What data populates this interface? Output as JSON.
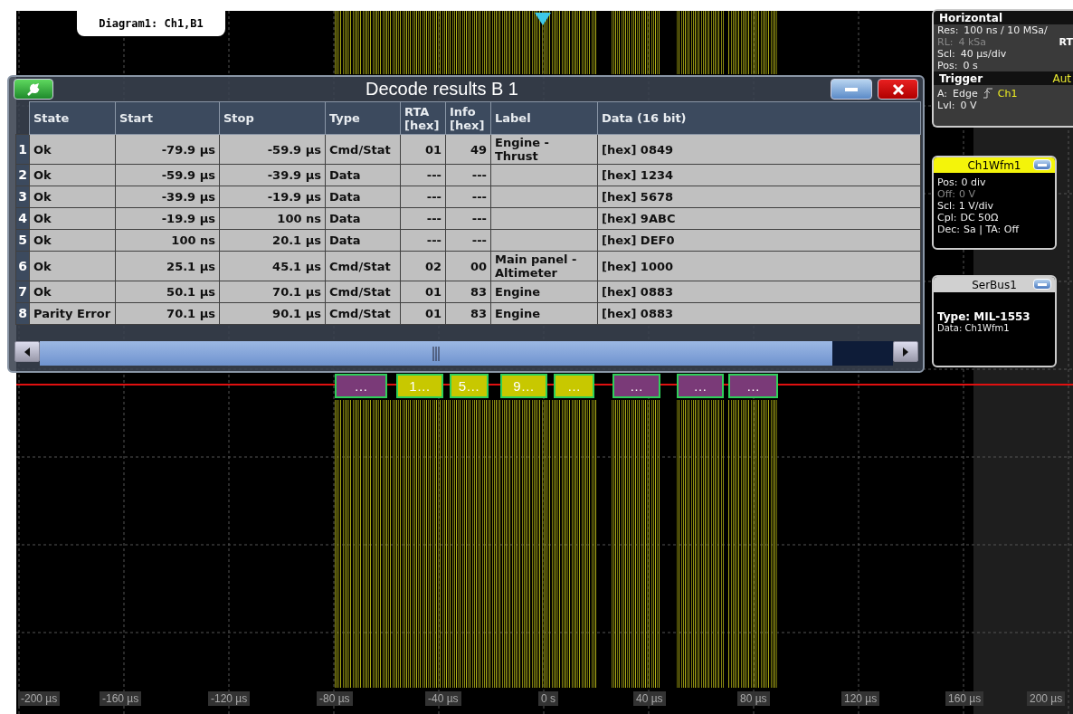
{
  "diagram_tab": "Diagram1: Ch1,B1",
  "decode_window": {
    "title": "Decode results B 1",
    "columns": [
      "State",
      "Start",
      "Stop",
      "Type",
      "RTA [hex]",
      "Info [hex]",
      "Label",
      "Data (16 bit)"
    ],
    "rows": [
      {
        "index": "1",
        "state": "Ok",
        "start": "-79.9 µs",
        "stop": "-59.9 µs",
        "type": "Cmd/Stat",
        "rta": "01",
        "info": "49",
        "label": "Engine - Thrust",
        "data": "[hex] 0849"
      },
      {
        "index": "2",
        "state": "Ok",
        "start": "-59.9 µs",
        "stop": "-39.9 µs",
        "type": "Data",
        "rta": "---",
        "info": "---",
        "label": "",
        "data": "[hex] 1234"
      },
      {
        "index": "3",
        "state": "Ok",
        "start": "-39.9 µs",
        "stop": "-19.9 µs",
        "type": "Data",
        "rta": "---",
        "info": "---",
        "label": "",
        "data": "[hex] 5678"
      },
      {
        "index": "4",
        "state": "Ok",
        "start": "-19.9 µs",
        "stop": "100 ns",
        "type": "Data",
        "rta": "---",
        "info": "---",
        "label": "",
        "data": "[hex] 9ABC"
      },
      {
        "index": "5",
        "state": "Ok",
        "start": "100 ns",
        "stop": "20.1 µs",
        "type": "Data",
        "rta": "---",
        "info": "---",
        "label": "",
        "data": "[hex] DEF0"
      },
      {
        "index": "6",
        "state": "Ok",
        "start": "25.1 µs",
        "stop": "45.1 µs",
        "type": "Cmd/Stat",
        "rta": "02",
        "info": "00",
        "label": "Main panel - Altimeter",
        "data": "[hex] 1000"
      },
      {
        "index": "7",
        "state": "Ok",
        "start": "50.1 µs",
        "stop": "70.1 µs",
        "type": "Cmd/Stat",
        "rta": "01",
        "info": "83",
        "label": "Engine",
        "data": "[hex] 0883"
      },
      {
        "index": "8",
        "state": "Parity Error",
        "start": "70.1 µs",
        "stop": "90.1 µs",
        "type": "Cmd/Stat",
        "rta": "01",
        "info": "83",
        "label": "Engine",
        "data": "[hex] 0883"
      }
    ]
  },
  "bus_frames": [
    {
      "kind": "command",
      "text": "…"
    },
    {
      "kind": "data",
      "text": "1…"
    },
    {
      "kind": "data",
      "text": "5…"
    },
    {
      "kind": "data",
      "text": "9…"
    },
    {
      "kind": "data",
      "text": "…"
    },
    {
      "kind": "command",
      "text": "…"
    },
    {
      "kind": "command",
      "text": "…"
    },
    {
      "kind": "command",
      "text": "…"
    }
  ],
  "x_axis": {
    "labels": [
      "-200 µs",
      "-160 µs",
      "-120 µs",
      "-80 µs",
      "-40 µs",
      "0 s",
      "40 µs",
      "80 µs",
      "120 µs",
      "160 µs",
      "200 µs"
    ]
  },
  "horizontal": {
    "title": "Horizontal",
    "mode": "RT",
    "lines": [
      {
        "label": "Res:",
        "value": "100 ns / 10 MSa/",
        "disabled": false
      },
      {
        "label": "RL:",
        "value": "4 kSa",
        "disabled": true
      },
      {
        "label": "Scl:",
        "value": "40 µs/div",
        "disabled": false
      },
      {
        "label": "Pos:",
        "value": "0 s",
        "disabled": false
      }
    ]
  },
  "trigger": {
    "title": "Trigger",
    "mode": "Aut",
    "source_label": "A:",
    "type": "Edge",
    "source": "Ch1",
    "level_label": "Lvl:",
    "level_value": "0 V"
  },
  "channel": {
    "title": "Ch1Wfm1",
    "lines": [
      {
        "label": "Pos:",
        "value": "0 div",
        "disabled": false
      },
      {
        "label": "Off:",
        "value": "0 V",
        "disabled": true
      },
      {
        "label": "Scl:",
        "value": "1 V/div",
        "disabled": false
      },
      {
        "label": "Cpl:",
        "value": "DC 50Ω",
        "disabled": false
      },
      {
        "label": "Dec:",
        "value": "Sa | TA: Off",
        "disabled": false
      }
    ]
  },
  "serial_bus": {
    "title": "SerBus1",
    "type": "Type: MIL-1553",
    "data": "Data: Ch1Wfm1"
  }
}
